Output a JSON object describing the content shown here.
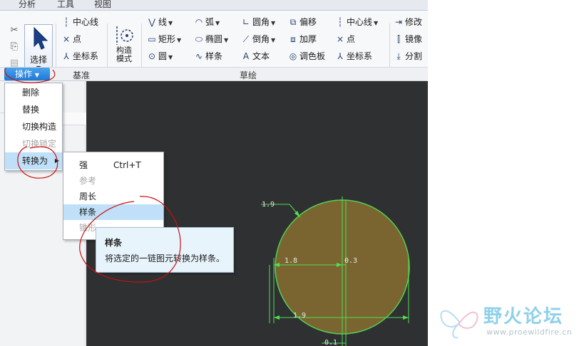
{
  "tabs": [
    "分析",
    "工具",
    "视图"
  ],
  "clipboard": {
    "cut_icon": "scissors-icon",
    "copy_icon": "copy-icon",
    "paste_icon": "paste-icon"
  },
  "select": {
    "label": "选择",
    "icon": "cursor-arrow-icon"
  },
  "datum": {
    "items": [
      {
        "label": "中心线",
        "icon": "centerline-icon"
      },
      {
        "label": "点",
        "icon": "point-icon"
      },
      {
        "label": "坐标系",
        "icon": "csys-icon"
      }
    ]
  },
  "construct": {
    "label_line1": "构造",
    "label_line2": "模式",
    "icon": "construction-mode-icon"
  },
  "sketch": {
    "col1": [
      {
        "label": "线",
        "icon": "line-icon"
      },
      {
        "label": "矩形",
        "icon": "rectangle-icon"
      },
      {
        "label": "圆",
        "icon": "circle-icon"
      }
    ],
    "col2": [
      {
        "label": "弧",
        "icon": "arc-icon"
      },
      {
        "label": "椭圆",
        "icon": "ellipse-icon"
      },
      {
        "label": "样条",
        "icon": "spline-icon"
      }
    ],
    "col3": [
      {
        "label": "圆角",
        "icon": "fillet-icon"
      },
      {
        "label": "倒角",
        "icon": "chamfer-icon"
      },
      {
        "label": "文本",
        "icon": "text-icon"
      }
    ],
    "col4": [
      {
        "label": "偏移",
        "icon": "offset-icon"
      },
      {
        "label": "加厚",
        "icon": "thicken-icon"
      },
      {
        "label": "调色板",
        "icon": "palette-icon"
      }
    ],
    "col5": [
      {
        "label": "中心线",
        "icon": "centerline-icon"
      },
      {
        "label": "点",
        "icon": "point-icon"
      },
      {
        "label": "坐标系",
        "icon": "csys-icon"
      }
    ],
    "col6": [
      {
        "label": "修改",
        "icon": "modify-icon"
      },
      {
        "label": "镜像",
        "icon": "mirror-icon"
      },
      {
        "label": "分割",
        "icon": "divide-icon"
      }
    ]
  },
  "groups": {
    "operations": "操作",
    "datum": "基准",
    "sketching": "草绘"
  },
  "operations_menu": [
    {
      "label": "删除",
      "enabled": true
    },
    {
      "label": "替换",
      "enabled": true
    },
    {
      "label": "切换构造",
      "enabled": true
    },
    {
      "label": "切换锁定",
      "enabled": false
    },
    {
      "label": "转换为",
      "enabled": true,
      "submenu": true
    }
  ],
  "convert_menu": [
    {
      "label": "强",
      "shortcut": "Ctrl+T",
      "enabled": true
    },
    {
      "label": "参考",
      "enabled": false
    },
    {
      "label": "周长",
      "enabled": true
    },
    {
      "label": "样条",
      "enabled": true,
      "active": true
    },
    {
      "label": "锥形",
      "enabled": false
    }
  ],
  "tooltip": {
    "title": "样条",
    "description": "将选定的一链图元转换为样条。"
  },
  "dimensions": {
    "d1": "1.9",
    "d2": "1.8",
    "d3": "0.3",
    "d4": "1.9",
    "d5": "0.1"
  },
  "watermark": {
    "title": "野火论坛",
    "url": "www.proewildfire.cn"
  },
  "colors": {
    "canvas_bg": "#2e3031",
    "circle_fill": "#7a6531",
    "circle_stroke": "#55d155",
    "dim_green": "#4fe04f",
    "annotation_red": "#cc1111"
  }
}
